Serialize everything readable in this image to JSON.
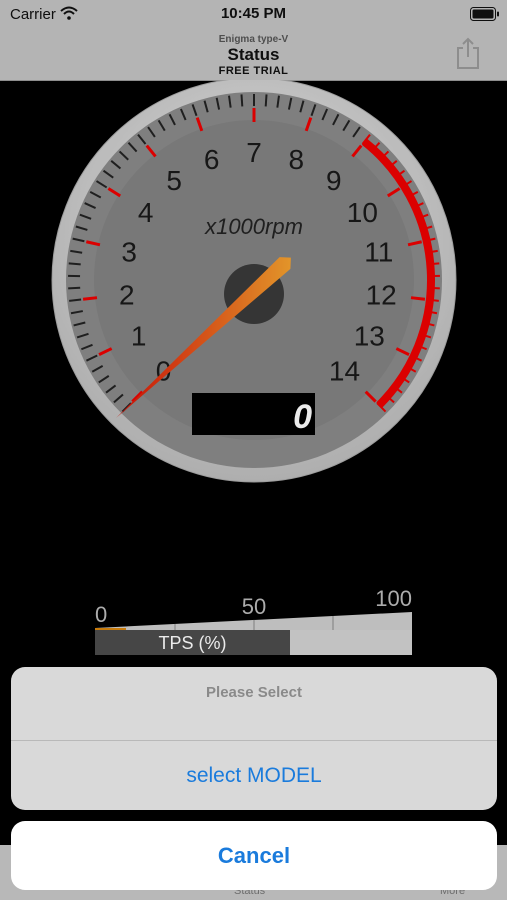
{
  "status_bar": {
    "carrier": "Carrier",
    "time": "10:45 PM"
  },
  "nav": {
    "subtitle": "Enigma type-V",
    "title": "Status",
    "badge": "FREE TRIAL"
  },
  "gauge": {
    "unit_label": "x1000rpm",
    "tick_labels": [
      "0",
      "1",
      "2",
      "3",
      "4",
      "5",
      "6",
      "7",
      "8",
      "9",
      "10",
      "11",
      "12",
      "13",
      "14"
    ],
    "max_rpm_thousands": 14,
    "redline_start_thousands": 9,
    "digital_readout": "0",
    "needle_value_thousands": 0,
    "colors": {
      "face": "#8a8a8a",
      "redline": "#ee0000",
      "needle": "#f04a10"
    }
  },
  "tps": {
    "scale_labels": [
      "0",
      "50",
      "100"
    ],
    "value_percent": 0,
    "label": "TPS (%)",
    "marker_color": "#d9870f"
  },
  "tabs": [
    "Status",
    "More"
  ],
  "action_sheet": {
    "title": "Please Select",
    "option": "select MODEL",
    "cancel": "Cancel"
  }
}
